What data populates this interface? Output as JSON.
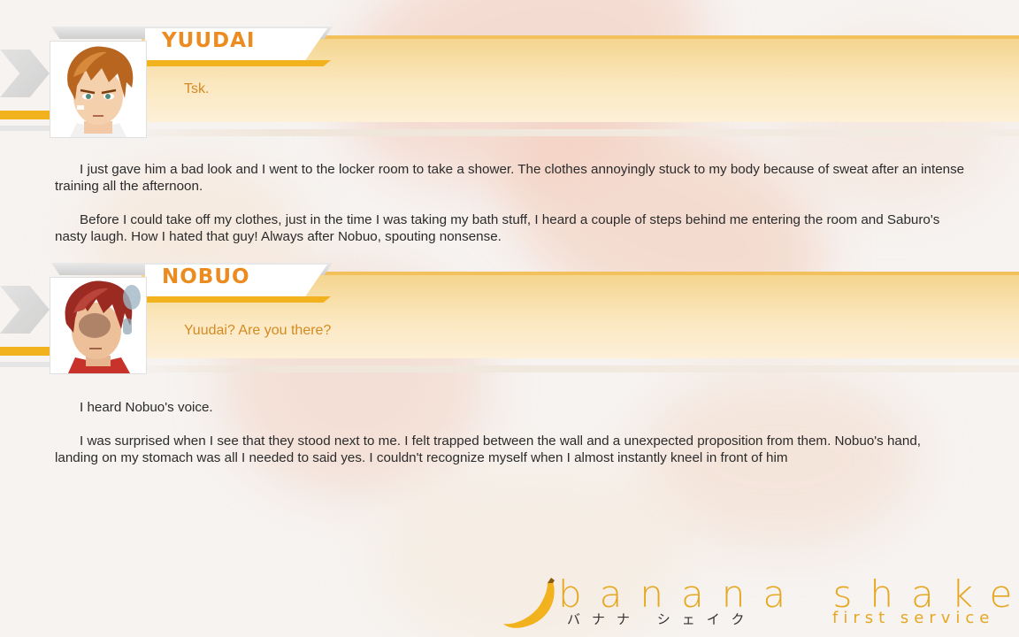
{
  "dialogues": [
    {
      "speaker": "YUUDAI",
      "line": "Tsk."
    },
    {
      "speaker": "NOBUO",
      "line": "Yuudai? Are you there?"
    }
  ],
  "narration": [
    [
      "I just gave him a bad look and I went to the locker room to take a shower. The clothes annoyingly stuck to my body because of sweat after an intense training all the afternoon.",
      "Before I could take off my clothes, just in the time I was taking my bath stuff, I heard a couple of steps behind me entering the room and Saburo's nasty laugh. How I hated that guy! Always after Nobuo, spouting nonsense."
    ],
    [
      "I heard Nobuo's voice.",
      "I was surprised when I see that they stood next to me. I felt trapped between the wall and a unexpected proposition from them. Nobuo's hand, landing on my stomach was all I needed to said yes. I couldn't recognize myself when I almost instantly kneel in front of him"
    ]
  ],
  "logo": {
    "title": "banana shake",
    "kana": "バナナ シェイク",
    "subtitle": "first service"
  },
  "colors": {
    "accent": "#f2b21d",
    "speaker": "#ec8b1f",
    "dialogue": "#d48a22"
  }
}
